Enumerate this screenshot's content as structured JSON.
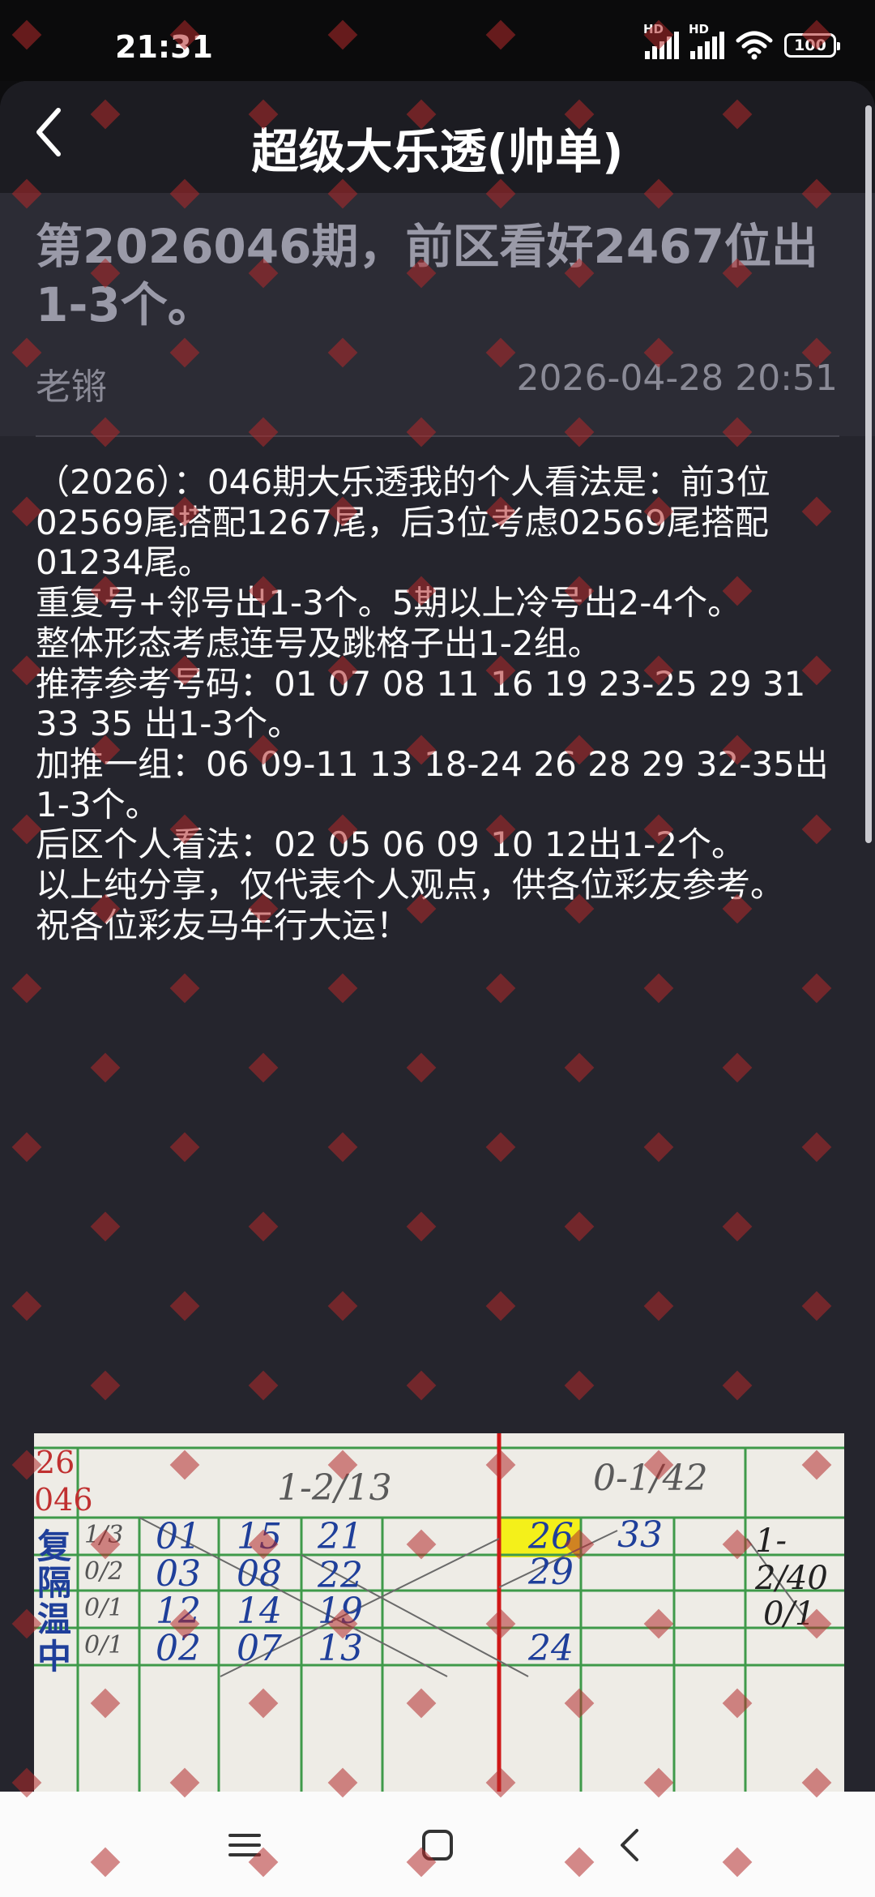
{
  "status_bar": {
    "time": "21:31",
    "signal1_badge": "HD",
    "signal2_badge": "HD",
    "battery": "100"
  },
  "header": {
    "title": "超级大乐透(帅单)",
    "back_icon": "chevron-left-icon"
  },
  "article": {
    "title": "第2026046期，前区看好2467位出1-3个。",
    "author": "老锵",
    "published": "2026-04-28 20:51",
    "paragraphs": [
      "（2026）：046期大乐透我的个人看法是：前3位02569尾搭配1267尾，后3位考虑02569尾搭配01234尾。",
      "重复号+邻号出1-3个。5期以上冷号出2-4个。",
      "整体形态考虑连号及跳格子出1-2组。",
      "推荐参考号码：01 07 08 11 16 19 23-25 29 31 33 35 出1-3个。",
      "加推一组：06 09-11 13 18-24 26 28 29 32-35出1-3个。",
      "后区个人看法：02 05 06 09 10 12出1-2个。",
      "以上纯分享，仅代表个人观点，供各位彩友参考。",
      "祝各位彩友马年行大运！"
    ]
  },
  "chart_photo": {
    "corner_top": "26",
    "corner_bottom": "046",
    "col_group1": "1-2/13",
    "col_group2": "0-1/42",
    "row_labels": [
      "复",
      "隔",
      "温",
      "中"
    ],
    "row_ratios": [
      "1/3",
      "0/2",
      "0/1",
      "0/1"
    ],
    "rows": [
      [
        "01",
        "15",
        "21",
        "26",
        "33"
      ],
      [
        "03",
        "08",
        "22",
        "29",
        ""
      ],
      [
        "12",
        "14",
        "19",
        "",
        ""
      ],
      [
        "02",
        "07",
        "13",
        "24",
        ""
      ]
    ],
    "right_note1": "1-2/40",
    "right_note2": "0/1",
    "colors": {
      "highlight": "#f4f01a",
      "ink": "#1f3f9a",
      "grid": "#3f9a4a",
      "red_line": "#d01818"
    }
  },
  "navbar": {
    "menu_icon": "menu-icon",
    "home_icon": "home-square-icon",
    "back_icon": "back-triangle-icon"
  }
}
